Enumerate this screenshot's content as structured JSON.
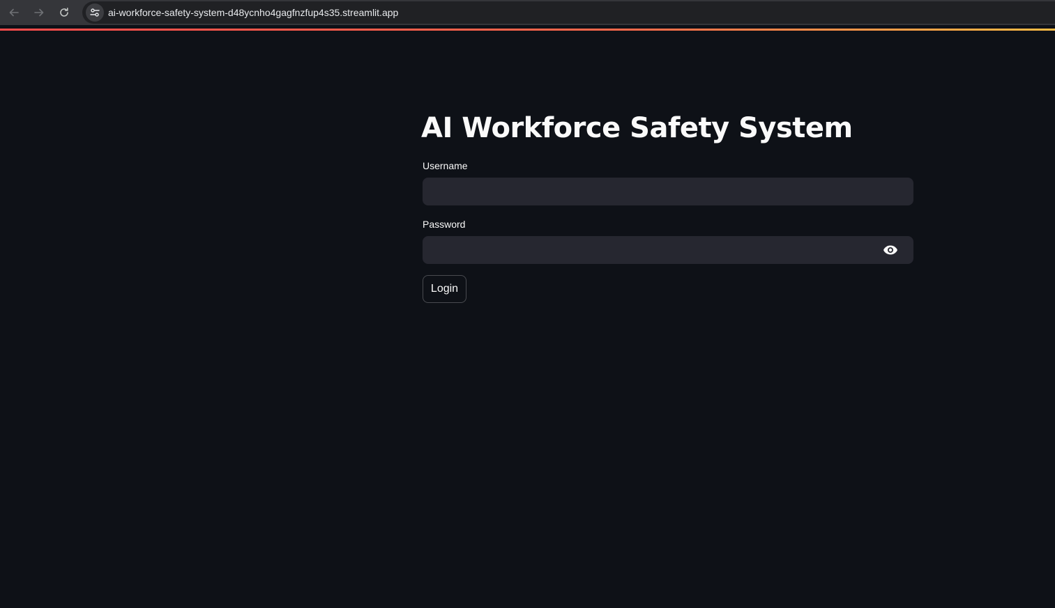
{
  "browser": {
    "url": "ai-workforce-safety-system-d48ycnho4gagfnzfup4s35.streamlit.app",
    "back_icon": "arrow-left-icon",
    "forward_icon": "arrow-right-icon",
    "reload_icon": "reload-icon",
    "site_info_icon": "tune-icon"
  },
  "app": {
    "title": "AI Workforce Safety System",
    "username": {
      "label": "Username",
      "value": "",
      "placeholder": ""
    },
    "password": {
      "label": "Password",
      "value": "",
      "placeholder": "",
      "toggle_icon": "eye-icon"
    },
    "login_label": "Login"
  },
  "colors": {
    "background": "#0e1117",
    "input_background": "#262730",
    "text": "#fafafa",
    "accent_start": "#ff4b4b",
    "accent_end": "#ffbd45"
  }
}
